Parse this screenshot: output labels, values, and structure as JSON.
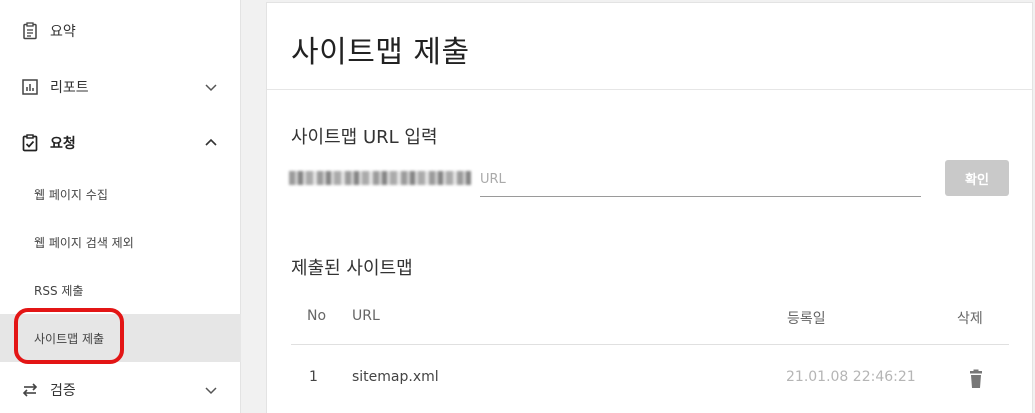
{
  "sidebar": {
    "groups": [
      {
        "label": "요약",
        "icon": "clipboard-icon"
      },
      {
        "label": "리포트",
        "icon": "bar-chart-icon",
        "chevron": "chevron-down-icon"
      },
      {
        "label": "요청",
        "icon": "clipboard-check-icon",
        "chevron": "chevron-up-icon"
      },
      {
        "label": "검증",
        "icon": "swap-arrows-icon",
        "chevron": "chevron-down-icon"
      }
    ],
    "request_items": [
      {
        "label": "웹 페이지 수집"
      },
      {
        "label": "웹 페이지 검색 제외"
      },
      {
        "label": "RSS 제출"
      },
      {
        "label": "사이트맵 제출",
        "active": true
      }
    ]
  },
  "main": {
    "title": "사이트맵 제출",
    "url_section_label": "사이트맵 URL 입력",
    "url_input": {
      "value": "",
      "placeholder": "URL"
    },
    "confirm_label": "확인",
    "submitted_label": "제출된 사이트맵",
    "table": {
      "headers": [
        "No",
        "URL",
        "등록일",
        "삭제"
      ],
      "rows": [
        {
          "no": "1",
          "url": "sitemap.xml",
          "date": "21.01.08 22:46:21",
          "action_icon": "trash-icon"
        }
      ]
    }
  },
  "colors": {
    "highlight": "#e31515",
    "active_bg": "#e6e6e6",
    "button_disabled": "#c9c9c9"
  }
}
